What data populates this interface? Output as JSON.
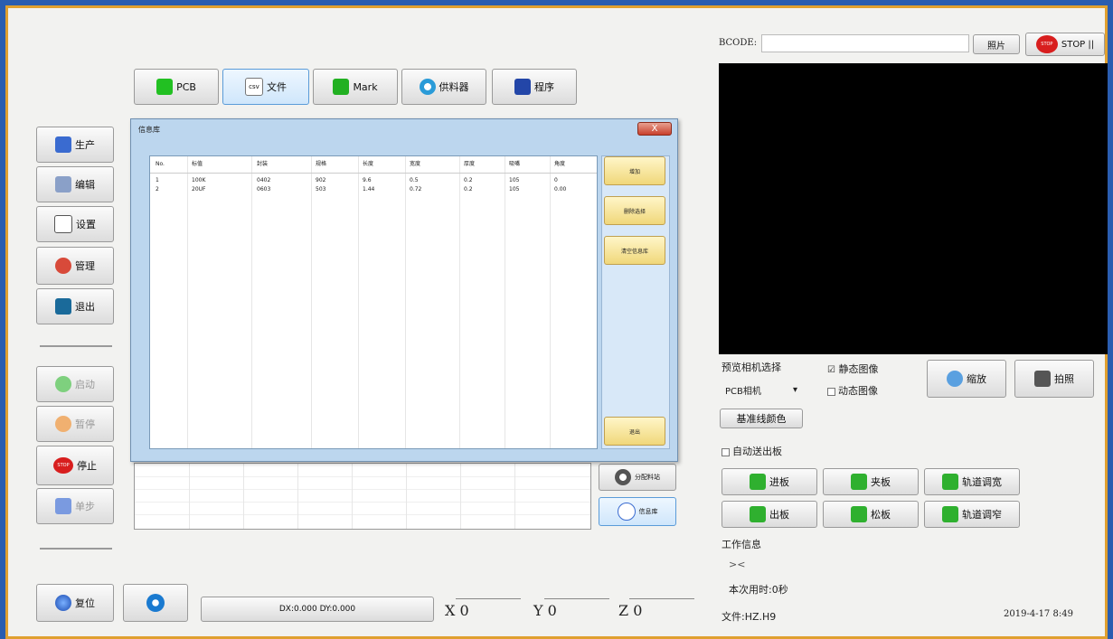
{
  "top_tabs": [
    {
      "label": "PCB",
      "icon": "pcb-icon"
    },
    {
      "label": "文件",
      "icon": "file-icon",
      "icon_text": "csv"
    },
    {
      "label": "Mark",
      "icon": "mark-icon"
    },
    {
      "label": "供料器",
      "icon": "feeder-icon"
    },
    {
      "label": "程序",
      "icon": "save-icon"
    }
  ],
  "left_menu": [
    {
      "label": "生产",
      "icon": "production-icon"
    },
    {
      "label": "编辑",
      "icon": "edit-icon"
    },
    {
      "label": "设置",
      "icon": "settings-icon"
    },
    {
      "label": "管理",
      "icon": "user-icon"
    },
    {
      "label": "退出",
      "icon": "exit-icon"
    }
  ],
  "controls": [
    {
      "label": "启动",
      "icon": "play-icon",
      "enabled": false
    },
    {
      "label": "暂停",
      "icon": "pause-icon",
      "enabled": false
    },
    {
      "label": "停止",
      "icon": "stop-icon",
      "enabled": true,
      "icon_text": "STOP"
    },
    {
      "label": "单步",
      "icon": "step-icon",
      "enabled": false
    }
  ],
  "bottom": {
    "reset_label": "复位",
    "status_text": "DX:0.000 DY:0.000",
    "coords": {
      "x": "X 0",
      "y": "Y 0",
      "z": "Z 0"
    }
  },
  "dialog": {
    "title": "信息库",
    "close_label": "X",
    "columns": [
      "No.",
      "标值",
      "封装",
      "规格",
      "长度",
      "宽度",
      "厚度",
      "吸嘴",
      "角度"
    ],
    "rows": [
      [
        "1",
        "100K",
        "0402",
        "902",
        "9.6",
        "0.5",
        "0.2",
        "105",
        "0"
      ],
      [
        "2",
        "20UF",
        "0603",
        "503",
        "1.44",
        "0.72",
        "0.2",
        "105",
        "0.00"
      ]
    ],
    "buttons": [
      "增加",
      "删除选择",
      "清空信息库"
    ],
    "exit_label": "退出"
  },
  "side_buttons": {
    "feeder_label": "分配料站",
    "library_label": "信息库"
  },
  "right": {
    "bcode_label": "BCODE:",
    "bcode_value": "",
    "image_button": "照片",
    "stop_text": "STOP",
    "stop_label": "STOP ||",
    "camera_select_label": "预览相机选择",
    "camera_select_value": "PCB相机",
    "static_image_label": "静态图像",
    "static_checked": "☑",
    "dynamic_image_label": "动态图像",
    "zoom_label": "缩放",
    "capture_label": "拍照",
    "baseline_color_label": "基准线颜色",
    "auto_unload_label": "自动送出板",
    "conveyor_buttons": [
      "进板",
      "夹板",
      "轨道调宽",
      "出板",
      "松板",
      "轨道调窄"
    ],
    "work_info_label": "工作信息",
    "work_info_symbol": "><",
    "elapsed_label": "本次用时:0秒",
    "file_label": "文件:HZ.H9",
    "datetime": "2019-4-17 8:49"
  },
  "colors": {
    "accent_blue": "#2a5db0",
    "frame_orange": "#e0a030",
    "panel_blue": "#bcd6ee",
    "yellow_button": "#f0d77a"
  }
}
